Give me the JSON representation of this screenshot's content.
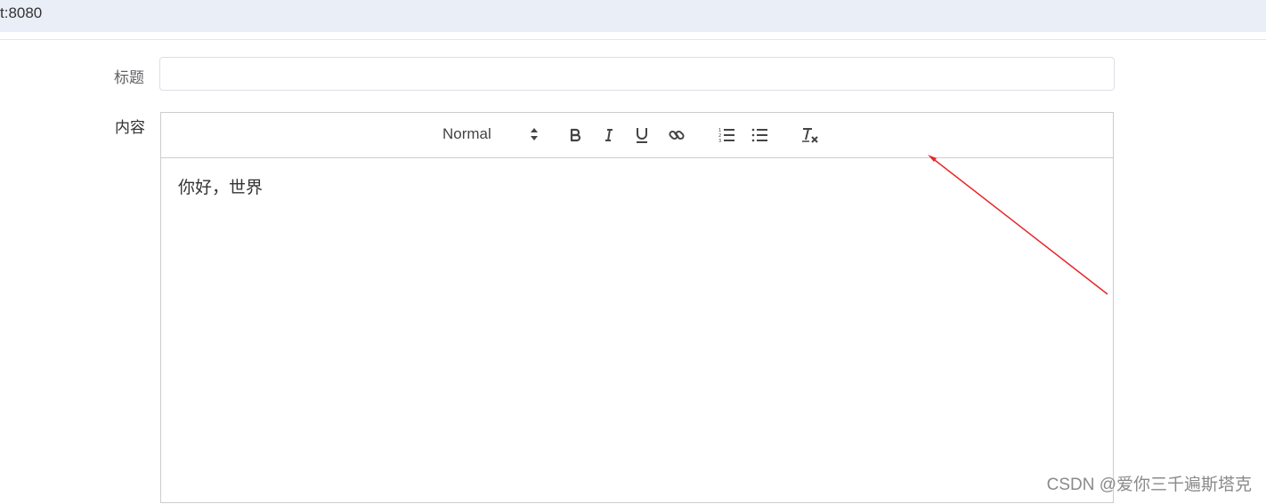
{
  "browser": {
    "url_fragment": "t:8080"
  },
  "form": {
    "title_label": "标题",
    "title_value": "",
    "content_label": "内容"
  },
  "editor": {
    "header_select_value": "Normal",
    "body_text": "你好，世界",
    "toolbar_icons": [
      "bold-icon",
      "italic-icon",
      "underline-icon",
      "link-icon",
      "ordered-list-icon",
      "bullet-list-icon",
      "clear-format-icon"
    ]
  },
  "annotation": {
    "arrow_color": "#e8262c"
  },
  "watermark": {
    "text": "CSDN @爱你三千遍斯塔克"
  }
}
